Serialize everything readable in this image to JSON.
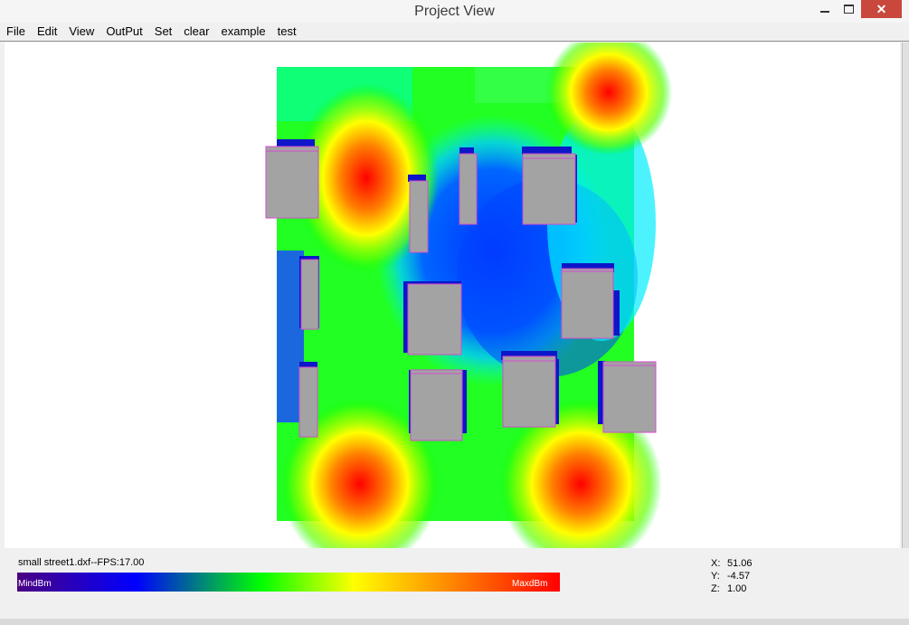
{
  "window": {
    "title": "Project View",
    "close_label": "✕"
  },
  "menu": {
    "items": [
      "File",
      "Edit",
      "View",
      "OutPut",
      "Set",
      "clear",
      "example",
      "test"
    ]
  },
  "status": {
    "info": "small street1.dxf--FPS:17.00",
    "legend_min": "MindBm",
    "legend_max": "MaxdBm",
    "x_label": "X:",
    "x_value": "51.06",
    "y_label": "Y:",
    "y_value": "-4.57",
    "z_label": "Z:",
    "z_value": "1.00"
  },
  "colors": {
    "heat_low": "#0000ff",
    "heat_mid": "#00ff00",
    "heat_high": "#ff0000",
    "building": "#a3a3a3",
    "building_outline": "#d34bd0"
  }
}
